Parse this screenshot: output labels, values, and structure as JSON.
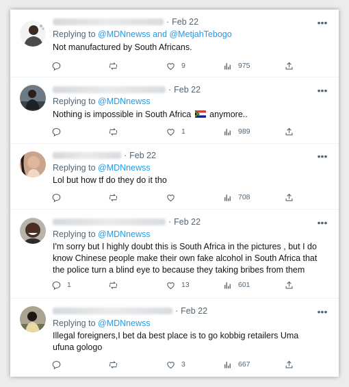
{
  "tweets": [
    {
      "date": "Feb 22",
      "replying_prefix": "Replying to",
      "handles": [
        "@MDNnewss",
        "@MetjahTebogo"
      ],
      "handle_joiner": "and",
      "text": "Not manufactured by South Africans.",
      "replies": "",
      "retweets": "",
      "likes": "9",
      "views": "975",
      "avatar": "man-with-beard-avatar"
    },
    {
      "date": "Feb 22",
      "replying_prefix": "Replying to",
      "handles": [
        "@MDNnewss"
      ],
      "text": "Nothing is impossible in South Africa",
      "text_suffix": "anymore..",
      "flag": "south-africa-flag-emoji",
      "replies": "",
      "retweets": "",
      "likes": "1",
      "views": "989",
      "avatar": "seated-man-avatar"
    },
    {
      "date": "Feb 22",
      "replying_prefix": "Replying to",
      "handles": [
        "@MDNnewss"
      ],
      "text": "Lol but how tf do they do it tho",
      "replies": "",
      "retweets": "",
      "likes": "",
      "views": "708",
      "avatar": "woman-portrait-avatar"
    },
    {
      "date": "Feb 22",
      "replying_prefix": "Replying to",
      "handles": [
        "@MDNnewss"
      ],
      "text": "I'm sorry but I highly doubt this is South Africa in the pictures , but I do know Chinese people make their own fake alcohol in South Africa that the police turn a blind eye to because they taking bribes from them",
      "replies": "1",
      "retweets": "",
      "likes": "13",
      "views": "601",
      "avatar": "smiling-man-avatar"
    },
    {
      "date": "Feb 22",
      "replying_prefix": "Replying to",
      "handles": [
        "@MDNnewss"
      ],
      "text": "Illegal foreigners,I bet da best place is to go kobbig retailers Uma ufuna gologo",
      "replies": "",
      "retweets": "",
      "likes": "3",
      "views": "667",
      "avatar": "man-outdoors-avatar"
    }
  ],
  "colors": {
    "link": "#1d9bf0",
    "muted": "#536471",
    "text": "#0f1419",
    "divider": "#eff3f4"
  }
}
